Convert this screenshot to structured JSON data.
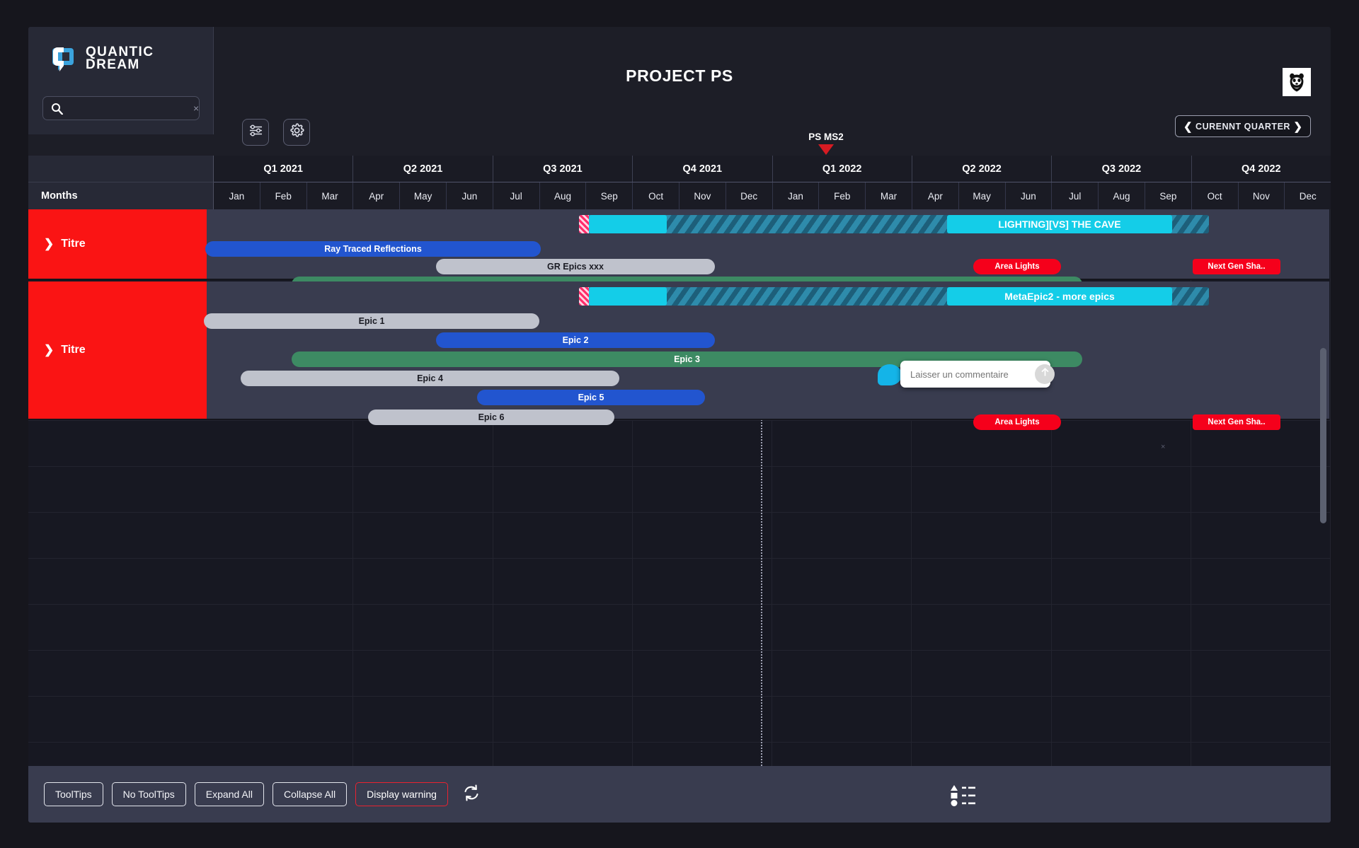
{
  "brand": {
    "logo_line1": "QUANTIC",
    "logo_line2": "DREAM",
    "logo_icon": "quantic-dream-q-logo",
    "corner_logo_icon": "wwf-panda-logo"
  },
  "header": {
    "title": "PROJECT PS",
    "quarter_nav": {
      "label": "CURENNT QUARTER",
      "prev_icon": "chevron-left-icon",
      "next_icon": "chevron-right-icon"
    },
    "milestone": {
      "label": "PS MS2",
      "marker_icon": "milestone-triangle-icon",
      "color": "#d61b22"
    }
  },
  "search": {
    "value": "",
    "placeholder": "",
    "icon": "search-icon",
    "clear_icon": "clear-icon",
    "clear_glyph": "×"
  },
  "toolbar": {
    "sliders_button": "sliders-icon",
    "gear_button": "gear-icon"
  },
  "timeline": {
    "left_header_label": "Months",
    "quarters": [
      "Q1 2021",
      "Q2 2021",
      "Q3 2021",
      "Q4 2021",
      "Q1 2022",
      "Q2 2022",
      "Q3 2022",
      "Q4 2022"
    ],
    "months": [
      "Jan",
      "Feb",
      "Mar",
      "Apr",
      "May",
      "Jun",
      "Jul",
      "Aug",
      "Sep",
      "Oct",
      "Nov",
      "Dec",
      "Jan",
      "Feb",
      "Mar",
      "Apr",
      "May",
      "Jun",
      "Jul",
      "Aug",
      "Sep",
      "Oct",
      "Nov",
      "Dec"
    ]
  },
  "groups": [
    {
      "title": "Titre",
      "expand_icon": "chevron-right-icon",
      "color": "#fa1414",
      "metabar": {
        "label": "LIGHTING][VS] THE CAVE"
      },
      "bars": [
        {
          "label": "Ray Traced Reflections",
          "color": "blue"
        },
        {
          "label": "GR Epics xxx",
          "color": "grey"
        },
        {
          "label": "",
          "color": "green"
        }
      ],
      "badges": [
        {
          "label": "Area Lights",
          "shape": "round"
        },
        {
          "label": "Next Gen Sha..",
          "shape": "soft"
        }
      ]
    },
    {
      "title": "Titre",
      "expand_icon": "chevron-right-icon",
      "color": "#fa1414",
      "metabar": {
        "label": "MetaEpic2 - more epics"
      },
      "bars": [
        {
          "label": "Epic 1",
          "color": "grey"
        },
        {
          "label": "Epic 2",
          "color": "blue"
        },
        {
          "label": "Epic 3",
          "color": "green"
        },
        {
          "label": "Epic 4",
          "color": "grey"
        },
        {
          "label": "Epic 5",
          "color": "blue"
        },
        {
          "label": "Epic 6",
          "color": "grey"
        }
      ],
      "badges": [
        {
          "label": "Area Lights",
          "shape": "round"
        },
        {
          "label": "Next Gen Sha..",
          "shape": "soft"
        }
      ]
    }
  ],
  "comment": {
    "bubble_icon": "comment-bubble-icon",
    "placeholder": "Laisser un commentaire",
    "value": "",
    "send_icon": "send-arrow-up-icon"
  },
  "grid_marker": {
    "glyph": "×"
  },
  "footer": {
    "buttons": [
      {
        "label": "ToolTips",
        "style": "normal"
      },
      {
        "label": "No ToolTips",
        "style": "normal"
      },
      {
        "label": "Expand All",
        "style": "normal"
      },
      {
        "label": "Collapse All",
        "style": "normal"
      },
      {
        "label": "Display warning",
        "style": "warn"
      }
    ],
    "refresh_icon": "refresh-icon",
    "legend_icon": "legend-list-icon"
  },
  "colors": {
    "accent_red": "#fa1414",
    "bar_blue": "#2255cf",
    "bar_grey": "#bfc2cc",
    "bar_green": "#3d8a63",
    "meta_cyan": "#14cde8",
    "badge_red": "#f5001b",
    "panel": "#393c4f",
    "background": "#171822"
  }
}
